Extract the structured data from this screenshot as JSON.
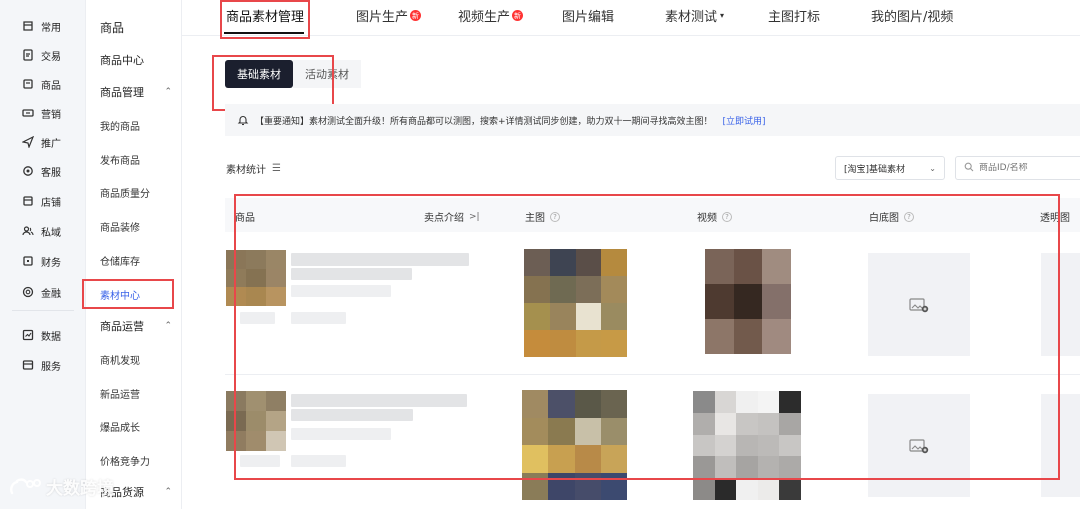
{
  "nav_primary": [
    {
      "label": "常用",
      "icon": "bookmark-icon"
    },
    {
      "label": "交易",
      "icon": "document-icon"
    },
    {
      "label": "商品",
      "icon": "product-icon"
    },
    {
      "label": "营销",
      "icon": "ticket-icon"
    },
    {
      "label": "推广",
      "icon": "send-icon"
    },
    {
      "label": "客服",
      "icon": "headset-icon"
    },
    {
      "label": "店铺",
      "icon": "store-icon"
    },
    {
      "label": "私域",
      "icon": "users-icon"
    },
    {
      "label": "财务",
      "icon": "wallet-icon"
    },
    {
      "label": "金融",
      "icon": "coin-icon"
    },
    {
      "label": "数据",
      "icon": "chart-icon"
    },
    {
      "label": "服务",
      "icon": "service-icon"
    }
  ],
  "nav_secondary": {
    "header": "商品",
    "item_center": "商品中心",
    "group_manage": "商品管理",
    "manage_items": [
      "我的商品",
      "发布商品",
      "商品质量分",
      "商品装修",
      "仓储库存",
      "素材中心"
    ],
    "group_ops": "商品运营",
    "ops_items": [
      "商机发现",
      "新品运营",
      "爆品成长",
      "价格竞争力"
    ],
    "group_source": "商品货源"
  },
  "tabs": [
    {
      "label": "商品素材管理",
      "badge": ""
    },
    {
      "label": "图片生产",
      "badge": "新"
    },
    {
      "label": "视频生产",
      "badge": "新"
    },
    {
      "label": "图片编辑",
      "badge": ""
    },
    {
      "label": "素材测试",
      "badge": ""
    },
    {
      "label": "主图打标",
      "badge": ""
    },
    {
      "label": "我的图片/视频",
      "badge": ""
    }
  ],
  "subtabs": {
    "basic": "基础素材",
    "activity": "活动素材"
  },
  "notice": {
    "text": "【重要通知】素材测试全面升级！所有商品都可以测图，搜索+详情测试同步创建，助力双十一期间寻找高效主图！",
    "link": "[立即试用]"
  },
  "stats": {
    "label": "素材统计",
    "select_value": "[淘宝]基础素材",
    "search_placeholder": "商品ID/名称"
  },
  "table": {
    "columns": [
      "商品",
      "卖点介绍",
      "主图",
      "视频",
      "白底图",
      "透明图"
    ]
  },
  "watermark": "大数跨境",
  "colors": {
    "accent": "#3a63e8",
    "highlight_box": "#e8474a",
    "active_tab_bg": "#1b1f2e"
  }
}
